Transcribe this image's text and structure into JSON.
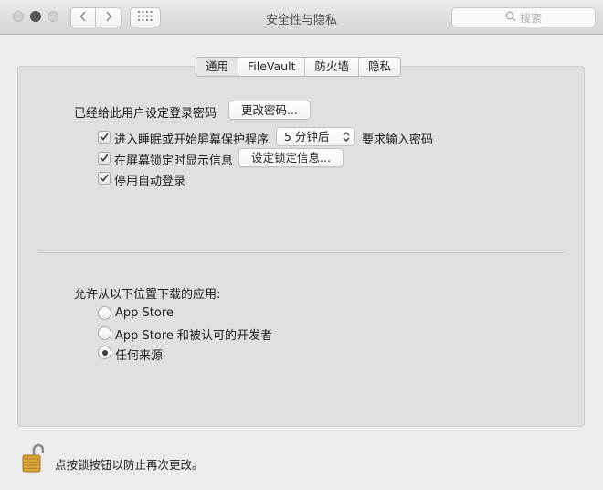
{
  "window": {
    "title": "安全性与隐私",
    "search_placeholder": "搜索",
    "icons": [
      "chevron-left-icon",
      "chevron-right-icon",
      "grid-icon",
      "search-icon"
    ]
  },
  "tabs": [
    {
      "label": "通用",
      "selected": true
    },
    {
      "label": "FileVault",
      "selected": false
    },
    {
      "label": "防火墙",
      "selected": false
    },
    {
      "label": "隐私",
      "selected": false
    }
  ],
  "general": {
    "password_set_label": "已经给此用户设定登录密码",
    "change_password_button": "更改密码...",
    "require_password": {
      "label_before": "进入睡眠或开始屏幕保护程序",
      "delay_value": "5 分钟后",
      "label_after": "要求输入密码",
      "checked": true
    },
    "show_message": {
      "label": "在屏幕锁定时显示信息",
      "button": "设定锁定信息...",
      "checked": true
    },
    "disable_auto_login": {
      "label": "停用自动登录",
      "checked": true
    }
  },
  "downloads": {
    "heading": "允许从以下位置下载的应用:",
    "options": [
      {
        "label": "App Store",
        "selected": false
      },
      {
        "label": "App Store 和被认可的开发者",
        "selected": false
      },
      {
        "label": "任何来源",
        "selected": true
      }
    ]
  },
  "footer": {
    "lock_text": "点按锁按钮以防止再次更改。",
    "lock_state": "unlocked"
  },
  "colors": {
    "window_bg": "#ececec",
    "panel_bg": "#e0e0e0",
    "lock_gold": "#d9a43a"
  }
}
